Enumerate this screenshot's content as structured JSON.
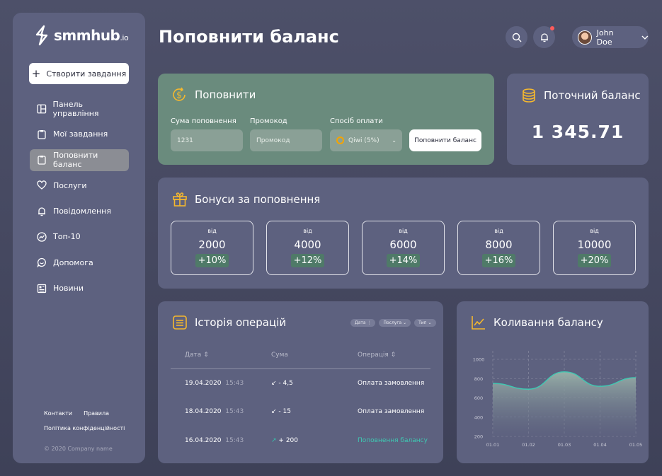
{
  "app": {
    "logo_text": "smmhub",
    "logo_suffix": ".io",
    "create_button": "Створити завдання",
    "nav": [
      {
        "label": "Панель управління",
        "icon": "dashboard-icon"
      },
      {
        "label": "Мої завдання",
        "icon": "clipboard-icon"
      },
      {
        "label": "Поповнити баланс",
        "icon": "wallet-icon",
        "active": true
      },
      {
        "label": "Послуги",
        "icon": "heart-icon"
      },
      {
        "label": "Повідомлення",
        "icon": "bell-icon"
      },
      {
        "label": "Топ-10",
        "icon": "trend-icon"
      },
      {
        "label": "Допомога",
        "icon": "chat-icon"
      },
      {
        "label": "Новини",
        "icon": "news-icon"
      }
    ],
    "footer": {
      "contacts": "Контакти",
      "rules": "Правила",
      "privacy": "Політика конфіденційності",
      "copyright": "© 2020 Company name"
    }
  },
  "header": {
    "title": "Поповнити баланс",
    "user_name": "John Doe"
  },
  "topup": {
    "title": "Поповнити",
    "amount_label": "Сума поповнення",
    "amount_value": "1231",
    "promo_label": "Промокод",
    "promo_placeholder": "Промокод",
    "method_label": "Спосіб оплати",
    "method_value": "Qiwi (5%)",
    "submit": "Поповнити баланс"
  },
  "balance": {
    "title": "Поточний баланс",
    "value": "1 345.71"
  },
  "bonus": {
    "title": "Бонуси за поповнення",
    "tiers": [
      {
        "from": "від",
        "amount": "2000",
        "percent": "+10%"
      },
      {
        "from": "від",
        "amount": "4000",
        "percent": "+12%"
      },
      {
        "from": "від",
        "amount": "6000",
        "percent": "+14%"
      },
      {
        "from": "від",
        "amount": "8000",
        "percent": "+16%"
      },
      {
        "from": "від",
        "amount": "10000",
        "percent": "+20%"
      }
    ]
  },
  "history": {
    "title": "Історія операцій",
    "filters": [
      "Дата",
      "Послуга",
      "Тип"
    ],
    "columns": [
      "Дата",
      "Сума",
      "Операція"
    ],
    "rows": [
      {
        "date": "19.04.2020",
        "time": "15:43",
        "sum": "- 4,5",
        "direction": "out",
        "operation": "Оплата замовлення"
      },
      {
        "date": "18.04.2020",
        "time": "15:43",
        "sum": "- 15",
        "direction": "out",
        "operation": "Оплата замовлення"
      },
      {
        "date": "16.04.2020",
        "time": "15:43",
        "sum": "+ 200",
        "direction": "in",
        "operation": "Поповнення балансу"
      }
    ]
  },
  "chart_data": {
    "type": "area",
    "title": "Коливання балансу",
    "x": [
      "01.01",
      "01.02",
      "01.03",
      "01.04",
      "01.05"
    ],
    "ylim": [
      200,
      1000
    ],
    "yticks": [
      200,
      400,
      600,
      800,
      1000
    ],
    "series": [
      {
        "values": [
          750,
          690,
          870,
          720,
          810
        ]
      }
    ],
    "grid": true
  },
  "colors": {
    "accent_teal": "#3ec9b3",
    "icon_gold": "#f5b82e",
    "topup_bg": "#6a8b7d",
    "card_bg": "#5d617f"
  }
}
